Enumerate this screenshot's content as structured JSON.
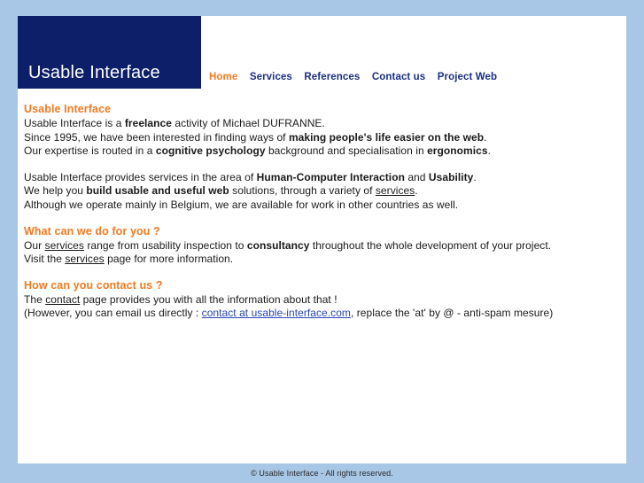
{
  "site": {
    "logo": "Usable Interface",
    "footer": "© Usable Interface - All rights reserved."
  },
  "nav": {
    "items": [
      {
        "label": "Home",
        "active": true
      },
      {
        "label": "Services",
        "active": false
      },
      {
        "label": "References",
        "active": false
      },
      {
        "label": "Contact us",
        "active": false
      },
      {
        "label": "Project Web",
        "active": false
      }
    ]
  },
  "sections": {
    "intro": {
      "title": "Usable Interface",
      "l1_a": "Usable Interface is a ",
      "l1_b": "freelance",
      "l1_c": " activity of Michael DUFRANNE.",
      "l2_a": "Since 1995, we have been interested in finding ways of ",
      "l2_b": "making people's life easier on the web",
      "l2_c": ".",
      "l3_a": "Our expertise is routed in a ",
      "l3_b": "cognitive psychology",
      "l3_c": " background and specialisation in ",
      "l3_d": "ergonomics",
      "l3_e": "."
    },
    "services_intro": {
      "l1_a": "Usable Interface provides services in the area of ",
      "l1_b": "Human-Computer Interaction",
      "l1_c": " and ",
      "l1_d": "Usability",
      "l1_e": ".",
      "l2_a": "We help you ",
      "l2_b": "build usable and useful web",
      "l2_c": " solutions, through a variety of ",
      "l2_link": "services",
      "l2_d": ".",
      "l3": "Although we operate mainly in Belgium, we are available for work in other countries as well."
    },
    "what_we_do": {
      "title": "What can we do for you ?",
      "l1_a": "Our ",
      "l1_link": "services",
      "l1_b": " range from usability inspection to ",
      "l1_c": "consultancy",
      "l1_d": " throughout the whole development of your project.",
      "l2_a": "Visit the ",
      "l2_link": "services",
      "l2_b": " page for more information."
    },
    "contact": {
      "title": "How can you contact us ?",
      "l1_a": "The ",
      "l1_link": "contact",
      "l1_b": " page provides you with all the information about that !",
      "l2_a": "(However, you can email us directly : ",
      "l2_link": "contact at usable-interface.com",
      "l2_b": ", replace the 'at' by @ - anti-spam mesure)"
    }
  },
  "colors": {
    "page_background": "#a8c6e5",
    "sheet": "#ffffff",
    "logo_block": "#0c1f68",
    "accent_orange": "#f57920",
    "nav_blue": "#1b2f86",
    "mail_link_blue": "#2a45b8"
  }
}
